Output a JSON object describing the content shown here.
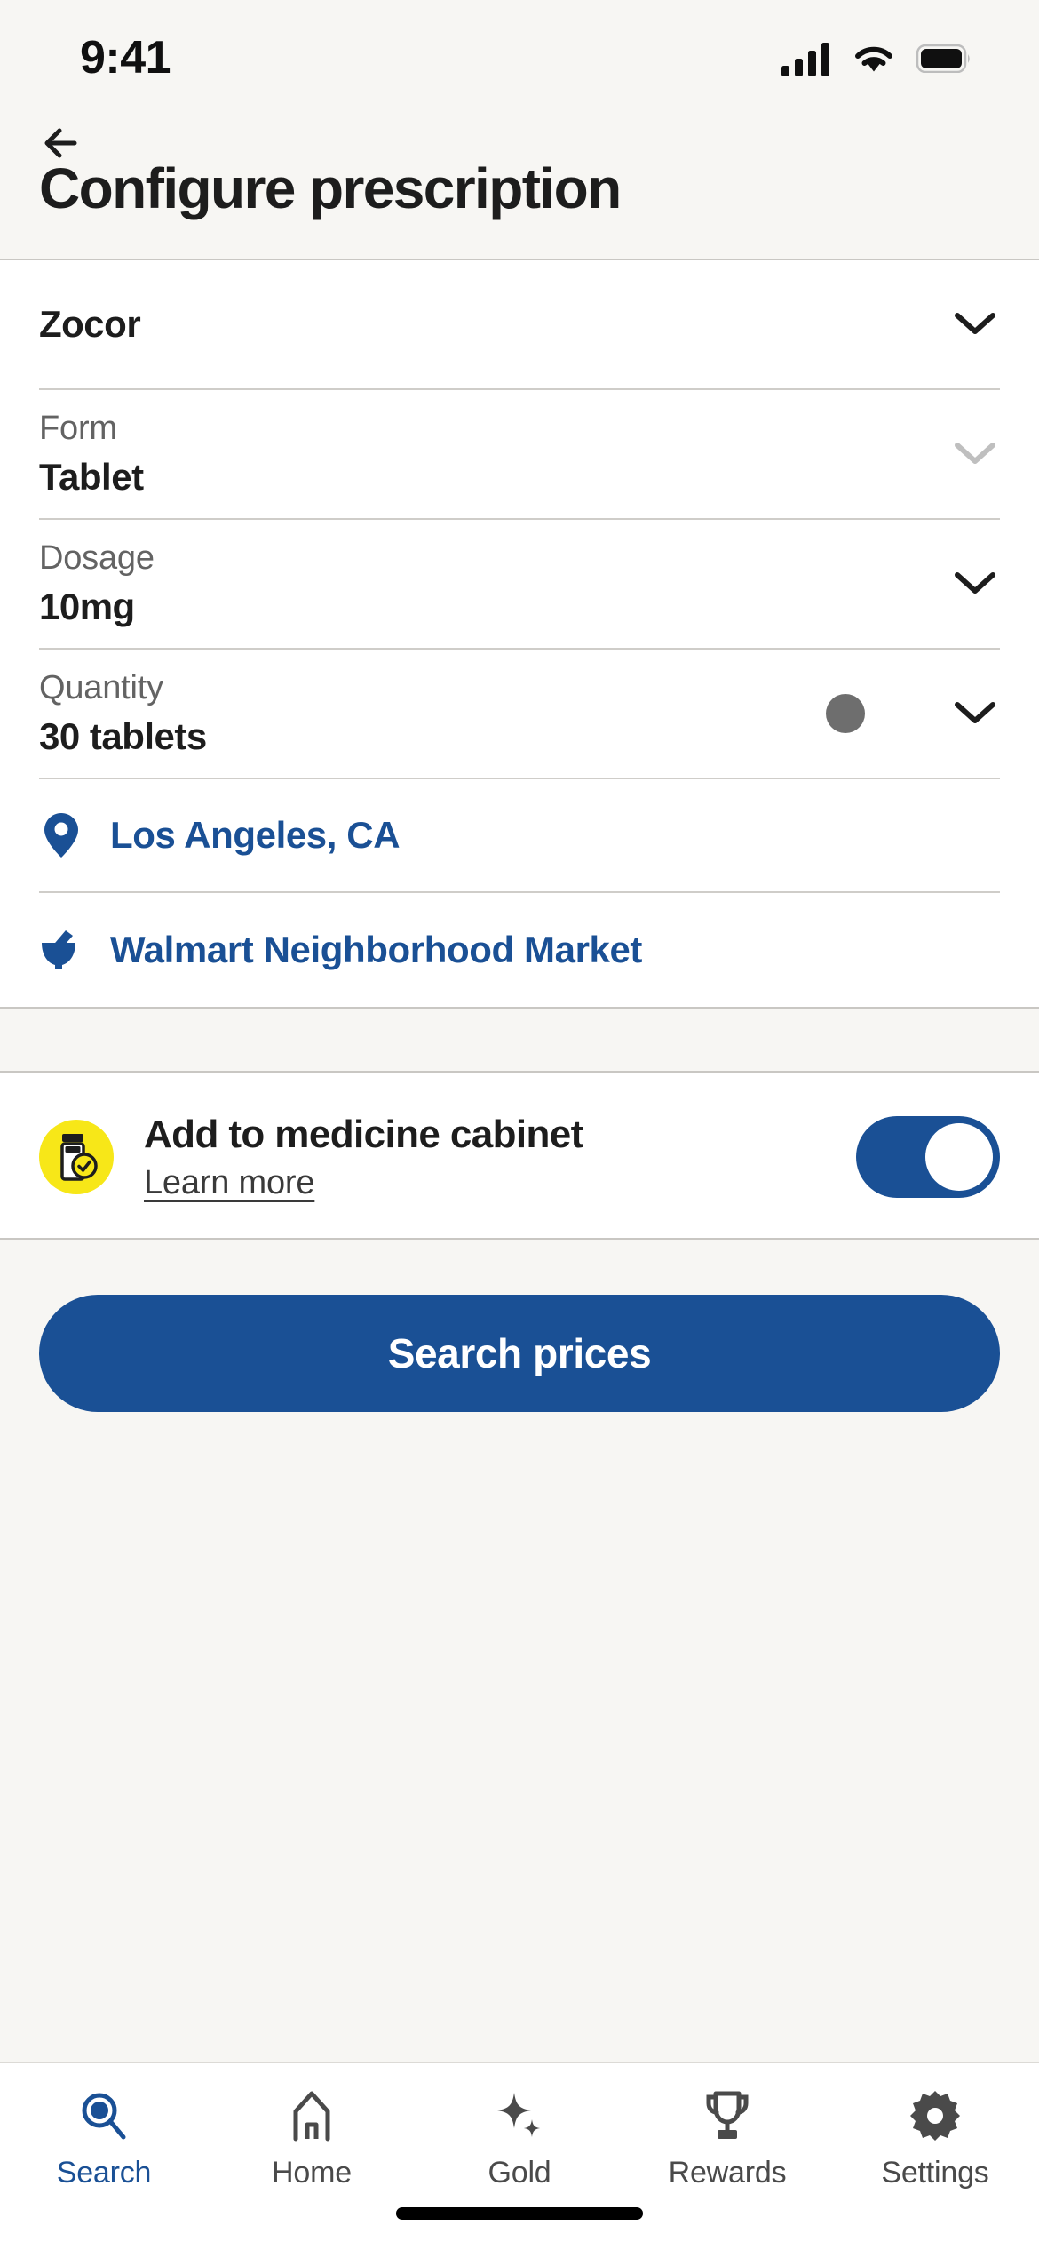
{
  "status_bar": {
    "time": "9:41",
    "icons": [
      "cellular-signal-icon",
      "wifi-icon",
      "battery-icon"
    ]
  },
  "header": {
    "back_icon": "arrow-left-icon",
    "title": "Configure prescription"
  },
  "form": {
    "drug": {
      "value": "Zocor",
      "chevron": "chevron-down-icon",
      "enabled": true
    },
    "fields": [
      {
        "label": "Form",
        "value": "Tablet",
        "chevron": "chevron-down-icon",
        "enabled": false,
        "dot": false
      },
      {
        "label": "Dosage",
        "value": "10mg",
        "chevron": "chevron-down-icon",
        "enabled": true,
        "dot": false
      },
      {
        "label": "Quantity",
        "value": "30 tablets",
        "chevron": "chevron-down-icon",
        "enabled": true,
        "dot": true
      }
    ],
    "links": [
      {
        "icon": "location-pin-icon",
        "text": "Los Angeles, CA"
      },
      {
        "icon": "mortar-pestle-icon",
        "text": "Walmart Neighborhood Market"
      }
    ]
  },
  "medicine_cabinet": {
    "badge_icon": "pill-bottle-check-icon",
    "title": "Add to medicine cabinet",
    "link": "Learn more",
    "toggle_on": true
  },
  "cta": {
    "label": "Search prices"
  },
  "tabbar": {
    "items": [
      {
        "label": "Search",
        "icon": "search-icon",
        "active": true
      },
      {
        "label": "Home",
        "icon": "home-icon",
        "active": false
      },
      {
        "label": "Gold",
        "icon": "sparkle-icon",
        "active": false
      },
      {
        "label": "Rewards",
        "icon": "trophy-icon",
        "active": false
      },
      {
        "label": "Settings",
        "icon": "gear-icon",
        "active": false
      }
    ]
  },
  "colors": {
    "brand_blue": "#1a5095",
    "badge_yellow": "#f7e718",
    "header_bg": "#f7f6f3",
    "text_dark": "#1d1d1d",
    "text_muted": "#636363"
  }
}
